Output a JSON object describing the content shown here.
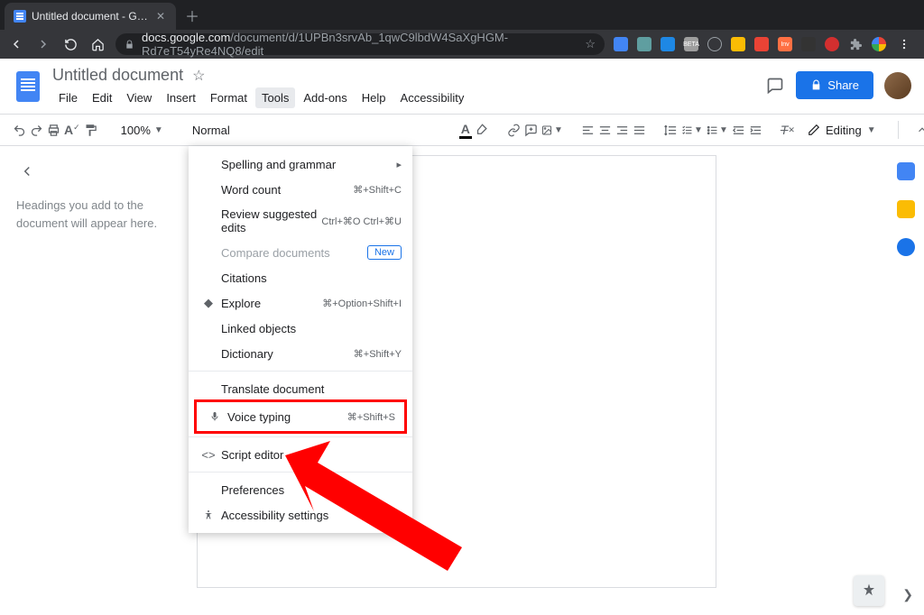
{
  "browser": {
    "tab_title": "Untitled document - Google D…",
    "url_host": "docs.google.com",
    "url_path": "/document/d/1UPBn3srvAb_1qwC9lbdW4SaXgHGM-Rd7eT54yRe4NQ8/edit"
  },
  "doc": {
    "title": "Untitled document",
    "menus": [
      "File",
      "Edit",
      "View",
      "Insert",
      "Format",
      "Tools",
      "Add-ons",
      "Help",
      "Accessibility"
    ],
    "active_menu_index": 5,
    "share_label": "Share"
  },
  "toolbar": {
    "zoom": "100%",
    "style": "Normal",
    "editing": "Editing"
  },
  "outline": {
    "placeholder": "Headings you add to the document will appear here."
  },
  "tools_menu": {
    "spelling": {
      "label": "Spelling and grammar"
    },
    "word_count": {
      "label": "Word count",
      "shortcut": "⌘+Shift+C"
    },
    "review": {
      "label": "Review suggested edits",
      "shortcut": "Ctrl+⌘O Ctrl+⌘U"
    },
    "compare": {
      "label": "Compare documents",
      "badge": "New"
    },
    "citations": {
      "label": "Citations"
    },
    "explore": {
      "label": "Explore",
      "shortcut": "⌘+Option+Shift+I"
    },
    "linked": {
      "label": "Linked objects"
    },
    "dictionary": {
      "label": "Dictionary",
      "shortcut": "⌘+Shift+Y"
    },
    "translate": {
      "label": "Translate document"
    },
    "voice": {
      "label": "Voice typing",
      "shortcut": "⌘+Shift+S"
    },
    "script": {
      "label": "Script editor"
    },
    "prefs": {
      "label": "Preferences"
    },
    "a11y": {
      "label": "Accessibility settings"
    }
  }
}
